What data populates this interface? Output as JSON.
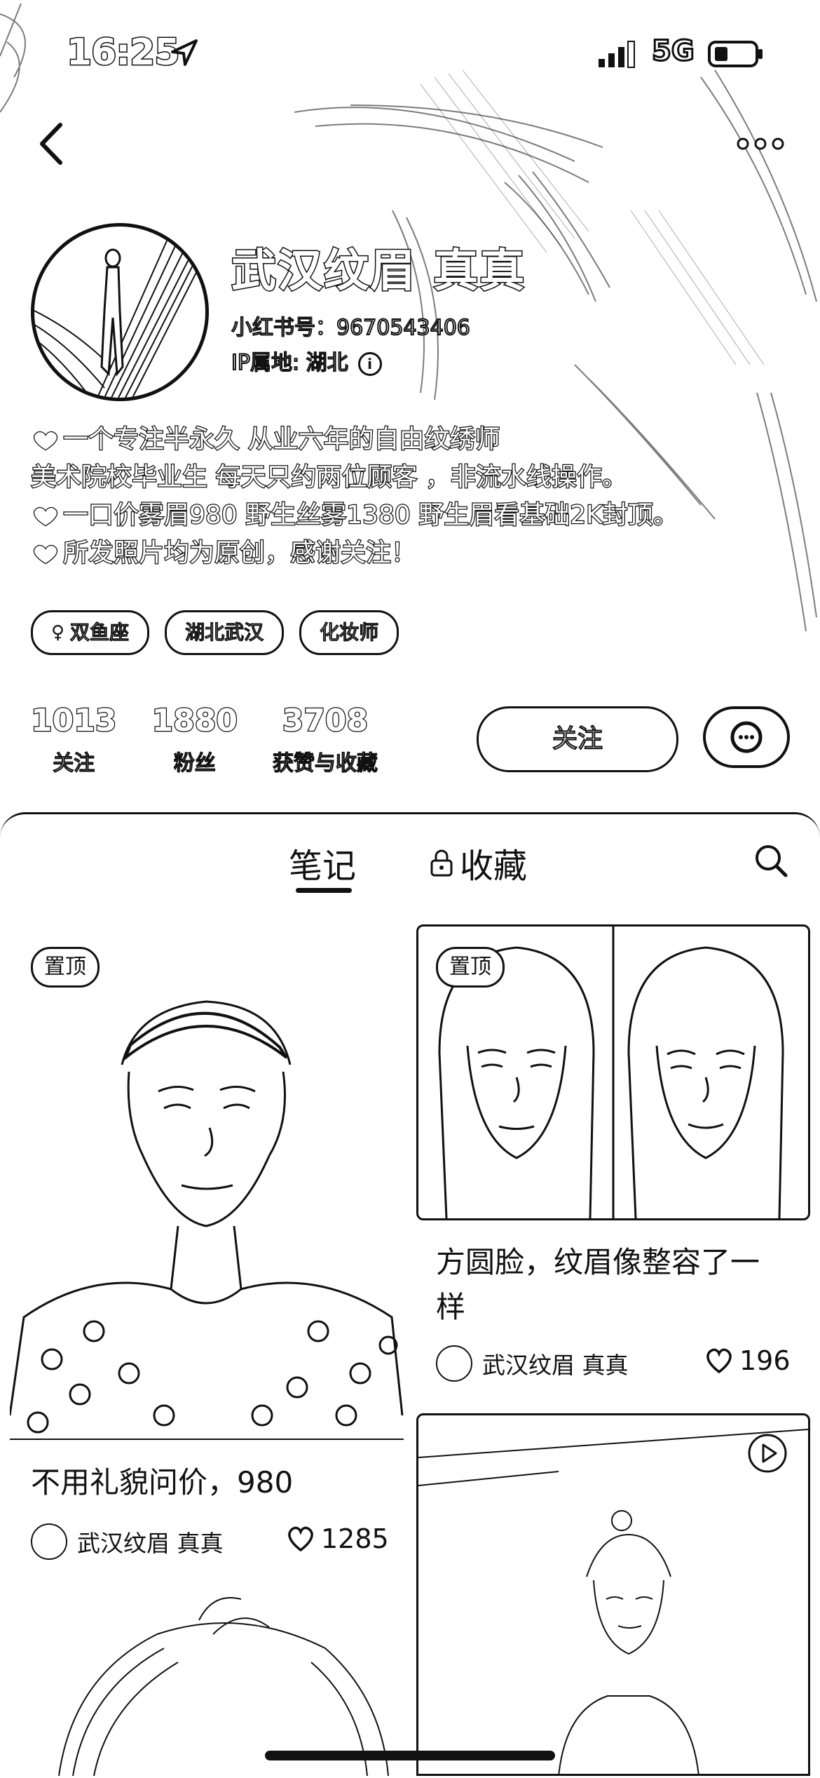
{
  "status_bar": {
    "time": "16:25",
    "network": "5G"
  },
  "profile": {
    "name": "武汉纹眉 真真",
    "redbook_id": "小红书号：9670543406",
    "ip_location": "IP属地: 湖北",
    "bio": [
      "一个专注半永久 从业六年的自由纹绣师",
      "美术院校毕业生  每天只约两位顾客 ，非流水线操作。",
      "一口价雾眉980  野生丝雾1380  野生眉看基础2K封顶。",
      "所发照片均为原创，感谢关注！"
    ],
    "tags": [
      "双鱼座",
      "湖北武汉",
      "化妆师"
    ],
    "stats": [
      {
        "num": "1013",
        "label": "关注"
      },
      {
        "num": "1880",
        "label": "粉丝"
      },
      {
        "num": "3708",
        "label": "获赞与收藏"
      }
    ],
    "follow_label": "关注"
  },
  "tabs": {
    "notes": "笔记",
    "collect": "收藏"
  },
  "feed": {
    "pinned_label": "置顶",
    "cards": [
      {
        "title": "不用礼貌问价，980",
        "author": "武汉纹眉 真真",
        "likes": "1285"
      },
      {
        "title": "方圆脸，纹眉像整容了一样",
        "author": "武汉纹眉 真真",
        "likes": "196"
      }
    ]
  }
}
